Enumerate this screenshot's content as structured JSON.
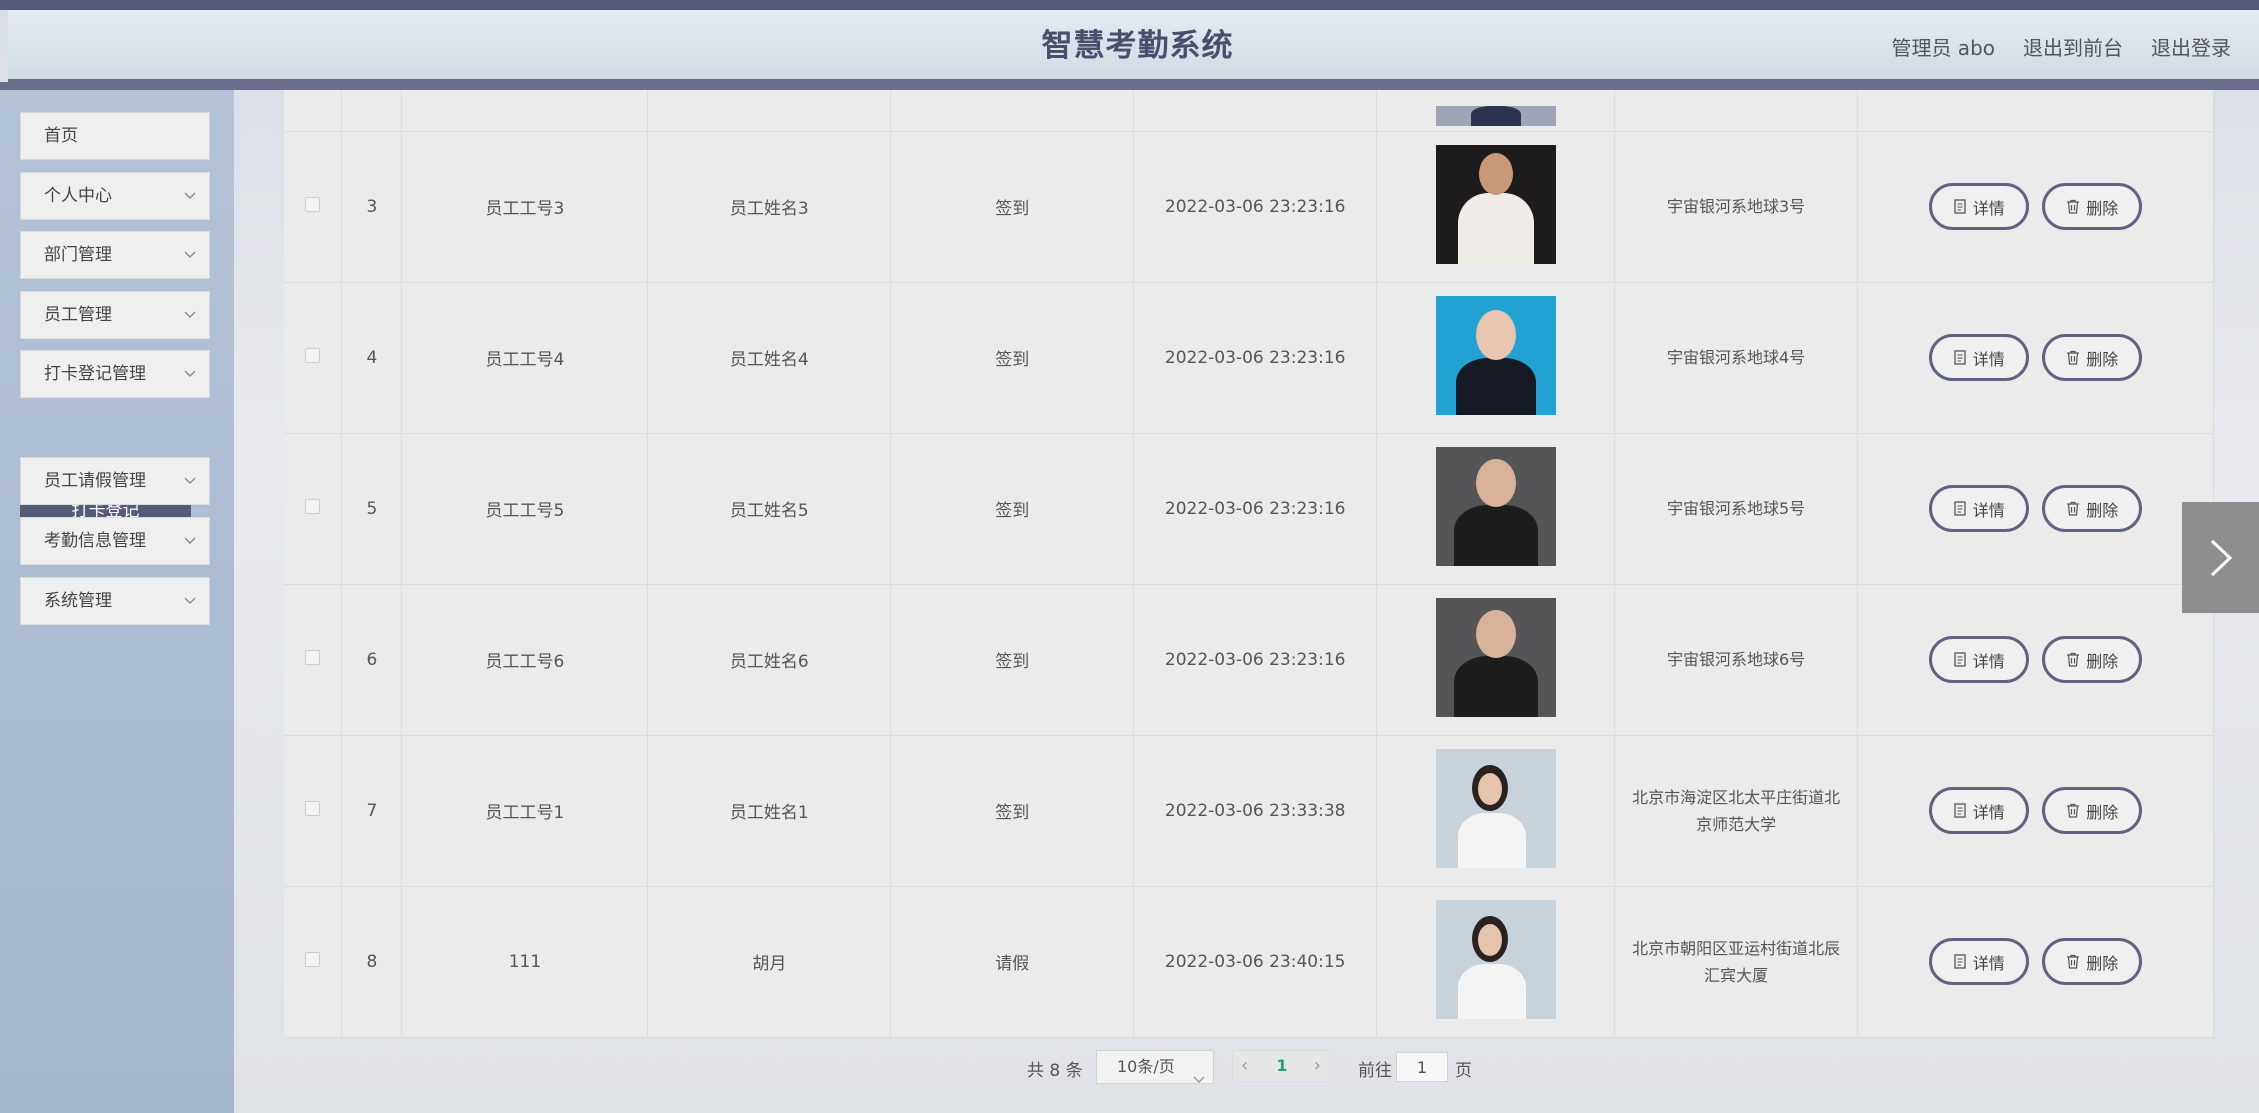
{
  "app": {
    "title": "智慧考勤系统",
    "admin_label": "管理员 abo",
    "to_front_label": "退出到前台",
    "logout_label": "退出登录"
  },
  "sidebar": {
    "items": [
      {
        "label": "首页"
      },
      {
        "label": "个人中心"
      },
      {
        "label": "部门管理"
      },
      {
        "label": "员工管理"
      },
      {
        "label": "打卡登记管理"
      },
      {
        "label": "员工请假管理"
      },
      {
        "label": "考勤信息管理"
      },
      {
        "label": "系统管理"
      }
    ],
    "submenu_active": "打卡登记"
  },
  "table": {
    "rows": [
      {
        "index": "3",
        "emp_id": "员工工号3",
        "emp_name": "员工姓名3",
        "type": "签到",
        "time": "2022-03-06 23:23:16",
        "addr1": "宇宙银河系地球3号",
        "addr2": ""
      },
      {
        "index": "4",
        "emp_id": "员工工号4",
        "emp_name": "员工姓名4",
        "type": "签到",
        "time": "2022-03-06 23:23:16",
        "addr1": "宇宙银河系地球4号",
        "addr2": ""
      },
      {
        "index": "5",
        "emp_id": "员工工号5",
        "emp_name": "员工姓名5",
        "type": "签到",
        "time": "2022-03-06 23:23:16",
        "addr1": "宇宙银河系地球5号",
        "addr2": ""
      },
      {
        "index": "6",
        "emp_id": "员工工号6",
        "emp_name": "员工姓名6",
        "type": "签到",
        "time": "2022-03-06 23:23:16",
        "addr1": "宇宙银河系地球6号",
        "addr2": ""
      },
      {
        "index": "7",
        "emp_id": "员工工号1",
        "emp_name": "员工姓名1",
        "type": "签到",
        "time": "2022-03-06 23:33:38",
        "addr1": "北京市海淀区北太平庄街道北",
        "addr2": "京师范大学"
      },
      {
        "index": "8",
        "emp_id": "111",
        "emp_name": "胡月",
        "type": "请假",
        "time": "2022-03-06 23:40:15",
        "addr1": "北京市朝阳区亚运村街道北辰",
        "addr2": "汇宾大厦"
      }
    ],
    "detail_label": "详情",
    "delete_label": "删除"
  },
  "pagination": {
    "total": "共 8 条",
    "page_size": "10条/页",
    "current_page": "1",
    "goto_label": "前往",
    "goto_value": "1",
    "page_suffix": "页"
  },
  "icons": {
    "chevron": "chevron-down-icon",
    "detail": "document-icon",
    "delete": "trash-icon",
    "next": "chevron-right-icon"
  },
  "colors": {
    "accent": "#5f6281",
    "active_submenu": "#565a78",
    "sidebar": "#a9b9d1",
    "current_page": "#2c9b7a"
  }
}
